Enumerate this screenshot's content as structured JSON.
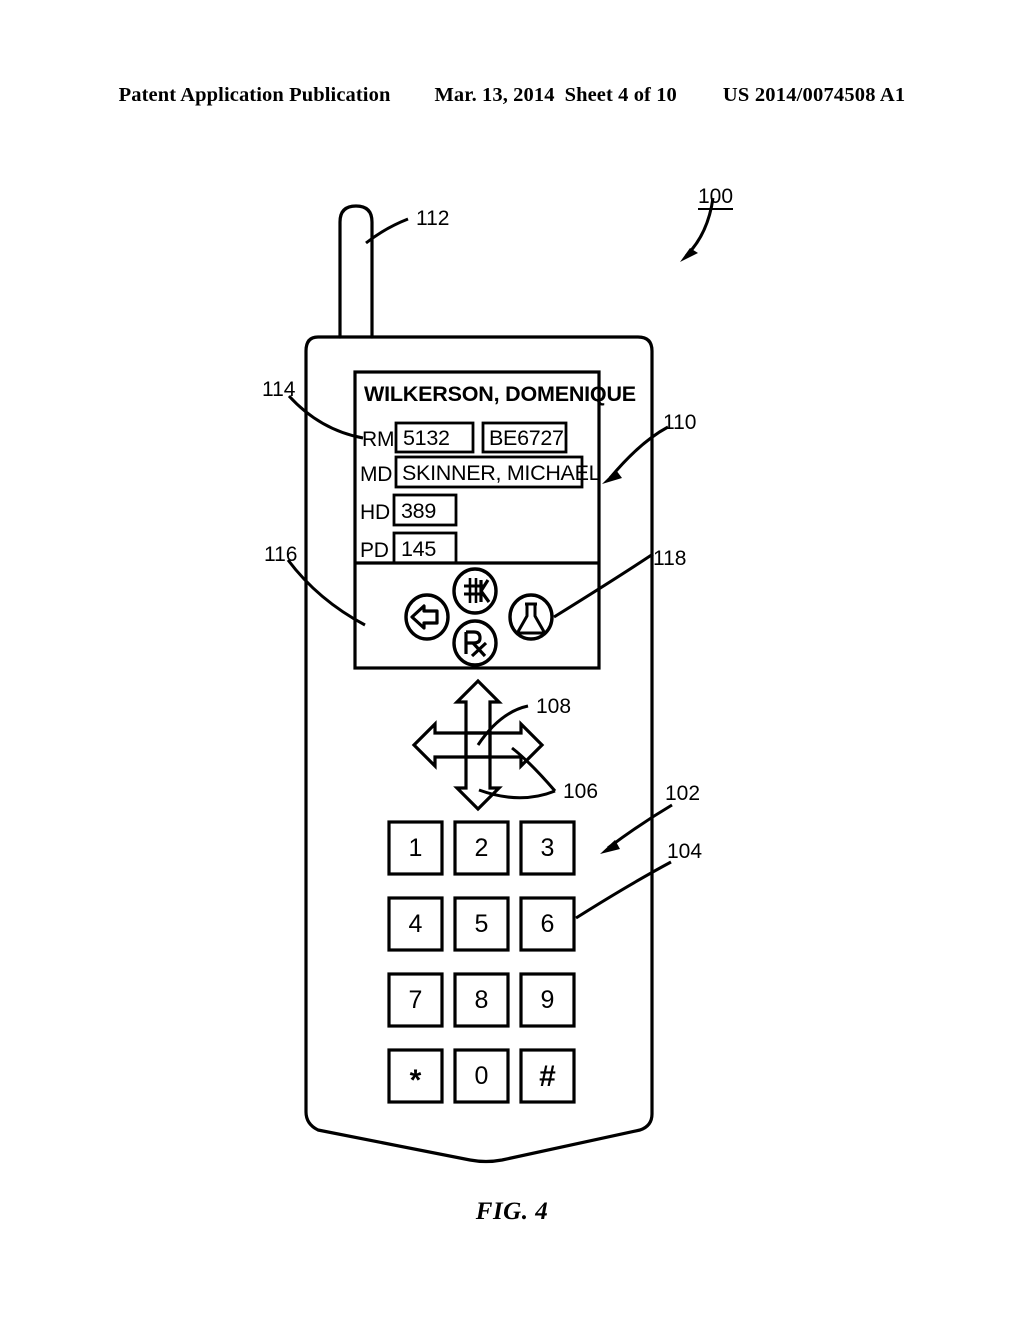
{
  "header": {
    "publication": "Patent Application Publication",
    "date": "Mar. 13, 2014",
    "sheet": "Sheet 4 of 10",
    "patent_number": "US 2014/0074508 A1"
  },
  "figure": {
    "caption": "FIG. 4",
    "reference_numerals": {
      "device": "100",
      "body": "102",
      "keypad_key": "104",
      "nav_arrows": "106",
      "nav_center": "108",
      "display": "110",
      "antenna": "112",
      "data_field_row": "114",
      "icon_panel": "116",
      "labs_icon": "118"
    }
  },
  "display": {
    "patient_name": "WILKERSON, DOMENIQUE",
    "fields": [
      {
        "label": "RM",
        "value": "5132"
      },
      {
        "label": "",
        "value": "BE6727"
      },
      {
        "label": "MD",
        "value": "SKINNER, MICHAEL"
      },
      {
        "label": "HD",
        "value": "389"
      },
      {
        "label": "PD",
        "value": "145"
      }
    ],
    "icons": [
      {
        "name": "back-arrow-icon",
        "glyph": "back"
      },
      {
        "name": "potassium-k-icon",
        "glyph": "K"
      },
      {
        "name": "prescription-rx-icon",
        "glyph": "Rx"
      },
      {
        "name": "lab-flask-icon",
        "glyph": "flask"
      }
    ]
  },
  "keypad": {
    "rows": [
      [
        "1",
        "2",
        "3"
      ],
      [
        "4",
        "5",
        "6"
      ],
      [
        "7",
        "8",
        "9"
      ],
      [
        "*",
        "0",
        "#"
      ]
    ]
  },
  "navpad": {
    "directions": [
      "up",
      "left",
      "right",
      "down"
    ],
    "center": "select"
  },
  "colors": {
    "ink": "#000000",
    "paper": "#ffffff"
  }
}
